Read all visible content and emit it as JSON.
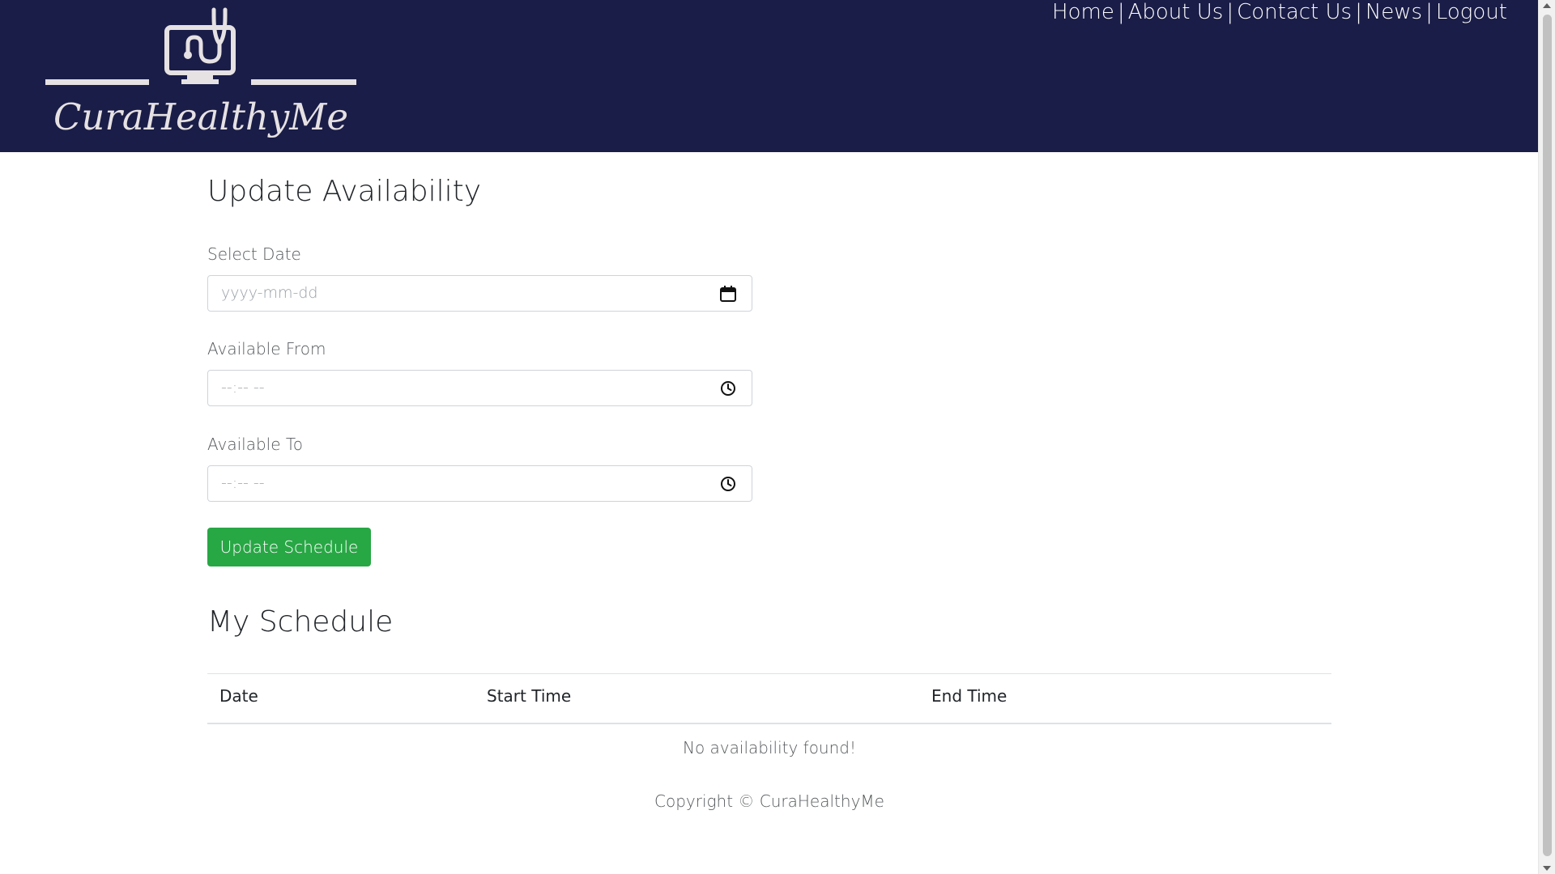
{
  "brand": {
    "name": "CuraHealthyMe",
    "logo_icon": "monitor-stethoscope-icon"
  },
  "nav": {
    "items": [
      "Home",
      "About Us",
      "Contact Us",
      "News",
      "Logout"
    ],
    "separator": "|"
  },
  "form": {
    "title": "Update Availability",
    "date": {
      "label": "Select Date",
      "placeholder": "yyyy-mm-dd",
      "icon": "calendar-icon"
    },
    "from": {
      "label": "Available From",
      "placeholder": "--:-- --",
      "icon": "clock-icon"
    },
    "to": {
      "label": "Available To",
      "placeholder": "--:-- --",
      "icon": "clock-icon"
    },
    "submit_label": "Update Schedule"
  },
  "schedule": {
    "title": "My Schedule",
    "columns": [
      "Date",
      "Start Time",
      "End Time"
    ],
    "empty_message": "No availability found!"
  },
  "footer": {
    "text": "Copyright © CuraHealthyMe"
  },
  "colors": {
    "header_bg": "#1a1d47",
    "button_green": "#28a745",
    "logo_fg": "#e6e1e3"
  }
}
